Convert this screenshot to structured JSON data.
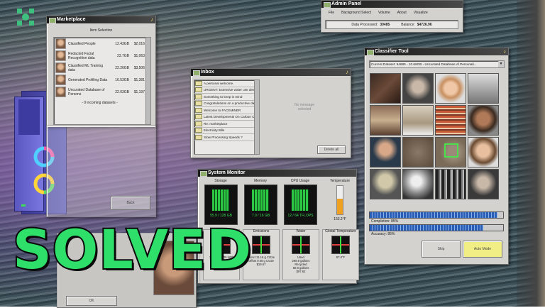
{
  "colors": {
    "accent_green": "#3fdc56",
    "progress_blue": "#2a5fb8",
    "solved_green": "#2ee06a",
    "auto_mode_yellow": "#f2ee86"
  },
  "overlay": {
    "solved_text": "SOLVED"
  },
  "marketplace": {
    "title": "Marketplace",
    "subtitle": "Item Selection",
    "items": [
      {
        "name": "Classified People",
        "size": "12.43GB",
        "price": "$2,016"
      },
      {
        "name": "Redacted Facial Recognition data",
        "size": "23.7GB",
        "price": "$1,063"
      },
      {
        "name": "Classified ML Training data",
        "size": "22.26GB",
        "price": "$3,506"
      },
      {
        "name": "Generated Profiling Data",
        "size": "16.53GB",
        "price": "$1,381"
      },
      {
        "name": "Uncurated Database of Persons",
        "size": "22.03GB",
        "price": "$1,197"
      }
    ],
    "incoming": "- 0 incoming datasets -",
    "back_label": "Back"
  },
  "admin": {
    "title": "Admin Panel",
    "menu": [
      "File",
      "Background Select",
      "Volume",
      "About",
      "Visualize"
    ],
    "data_processed_label": "Data Processed:",
    "data_processed_value": "30485",
    "balance_label": "Balance:",
    "balance_value": "$4726.96"
  },
  "inbox": {
    "title": "Inbox",
    "messages": [
      "A personal welcome.",
      "URGENT: Extensive water use detected!",
      "Something to keep in mind",
      "Congratulations on a productive day!",
      "Welcome to FACEMINER",
      "Latest Developments On Carbon Offsets",
      "Re: marketplace",
      "Electricity Bills",
      "Slow Processing Speeds ?"
    ],
    "no_message": "No message selected",
    "delete_all_label": "Delete all"
  },
  "classifier": {
    "title": "Classifier Tool",
    "dataset_select": "Current Dataset: 64685 - 10.69GB - Uncurated Database of Personali...",
    "completion_label": "Completion: 85%",
    "completion": 0.85,
    "accuracy_label": "Accuracy: 85%",
    "accuracy": 0.85,
    "progress_top": 0.96,
    "skip_label": "Skip",
    "auto_mode_label": "Auto Mode"
  },
  "system_monitor": {
    "title": "System Monitor",
    "meters": [
      {
        "label": "Storage",
        "value": "55.9 / 128 GB"
      },
      {
        "label": "Memory",
        "value": "7.0 / 16 GB"
      },
      {
        "label": "CPU Usage",
        "value": "12 / 64 TFLOPS"
      },
      {
        "label": "Temperature",
        "value": "153.2°F"
      }
    ],
    "stats": [
      {
        "label": "Power",
        "lines": [
          "270.31.28.05 kWh",
          "Generated",
          "2175.75 kWh",
          "Cost: $48.63"
        ]
      },
      {
        "label": "Emissions",
        "lines": [
          "Direct 11.16 g CO2e",
          "Offset 0.06 g CO2e",
          "$19.67"
        ]
      },
      {
        "label": "Water",
        "lines": [
          "Used",
          "298.9 gallons",
          "Recycled",
          "60.9 gallons",
          "$97.62"
        ]
      },
      {
        "label": "Global Temperature",
        "lines": [
          "57.0°F"
        ]
      }
    ]
  },
  "bottom_left": {
    "ok_label": "OK"
  }
}
